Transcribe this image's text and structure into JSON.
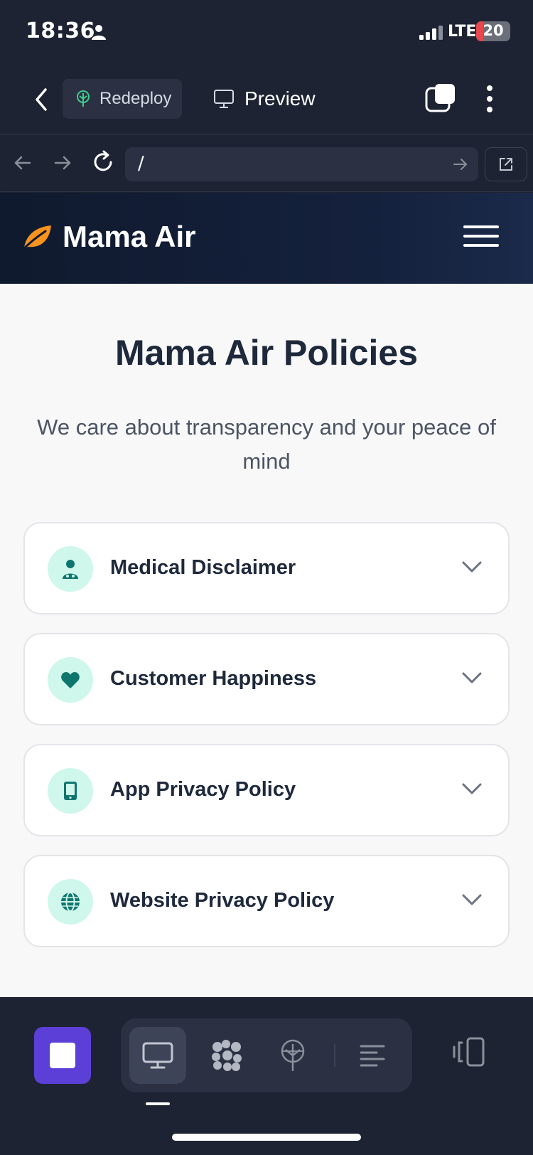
{
  "status_bar": {
    "time": "18:36",
    "network": "LTE",
    "battery": "20",
    "battery_level": 0.2
  },
  "app_bar": {
    "redeploy_label": "Redeploy",
    "preview_label": "Preview"
  },
  "url_bar": {
    "value": "/"
  },
  "site": {
    "brand_name": "Mama Air",
    "brand_color": "#f7931e"
  },
  "main": {
    "title": "Mama Air Policies",
    "subtitle": "We care about transparency and your peace of mind",
    "policies": [
      {
        "label": "Medical Disclaimer",
        "icon": "doctor-icon"
      },
      {
        "label": "Customer Happiness",
        "icon": "heart-icon"
      },
      {
        "label": "App Privacy Policy",
        "icon": "mobile-phone-icon"
      },
      {
        "label": "Website Privacy Policy",
        "icon": "globe-icon"
      }
    ]
  },
  "colors": {
    "accent_purple": "#5b3fd6",
    "icon_bg": "#cff7ec",
    "icon_fg": "#0f766e"
  }
}
